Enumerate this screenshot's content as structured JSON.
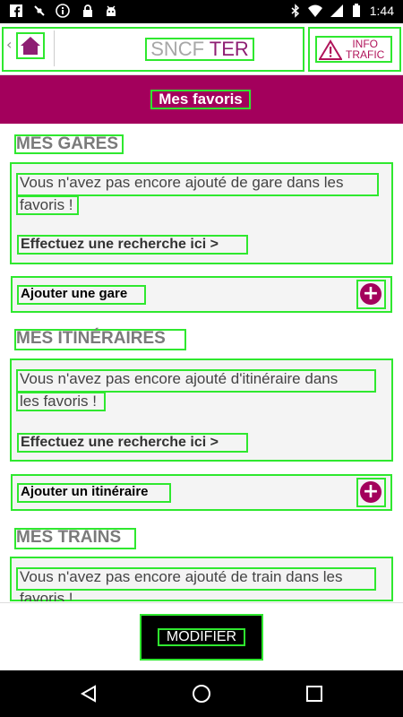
{
  "status_bar": {
    "time": "1:44",
    "icons": [
      "facebook-icon",
      "satellite-icon",
      "info-circle-icon",
      "lock-icon",
      "android-icon",
      "bluetooth-icon",
      "wifi-icon",
      "battery-icon"
    ]
  },
  "header": {
    "back_glyph": "‹",
    "logo_part1": "SNCF",
    "logo_part2": "TER",
    "info_line1": "INFO",
    "info_line2": "TRAFIC"
  },
  "page": {
    "title": "Mes favoris"
  },
  "sections": {
    "gares": {
      "heading": "MES GARES",
      "message_line1": "Vous n'avez pas encore ajouté de gare dans les",
      "message_line2": "favoris !",
      "search_link": "Effectuez une recherche ici >",
      "add_label": "Ajouter une gare"
    },
    "itineraires": {
      "heading": "MES ITINÉRAIRES",
      "message_line1": "Vous n'avez pas encore ajouté d'itinéraire dans",
      "message_line2": "les favoris !",
      "search_link": "Effectuez une recherche ici >",
      "add_label": "Ajouter un itinéraire"
    },
    "trains": {
      "heading": "MES TRAINS",
      "message_line1": "Vous n'avez pas encore ajouté de train dans les",
      "message_line2": "favoris !"
    }
  },
  "footer": {
    "modify_label": "MODIFIER"
  },
  "colors": {
    "brand": "#a3005c",
    "logo_grey": "#a7a7a7",
    "logo_purple": "#8e1e73",
    "highlight": "#2fe82f"
  }
}
